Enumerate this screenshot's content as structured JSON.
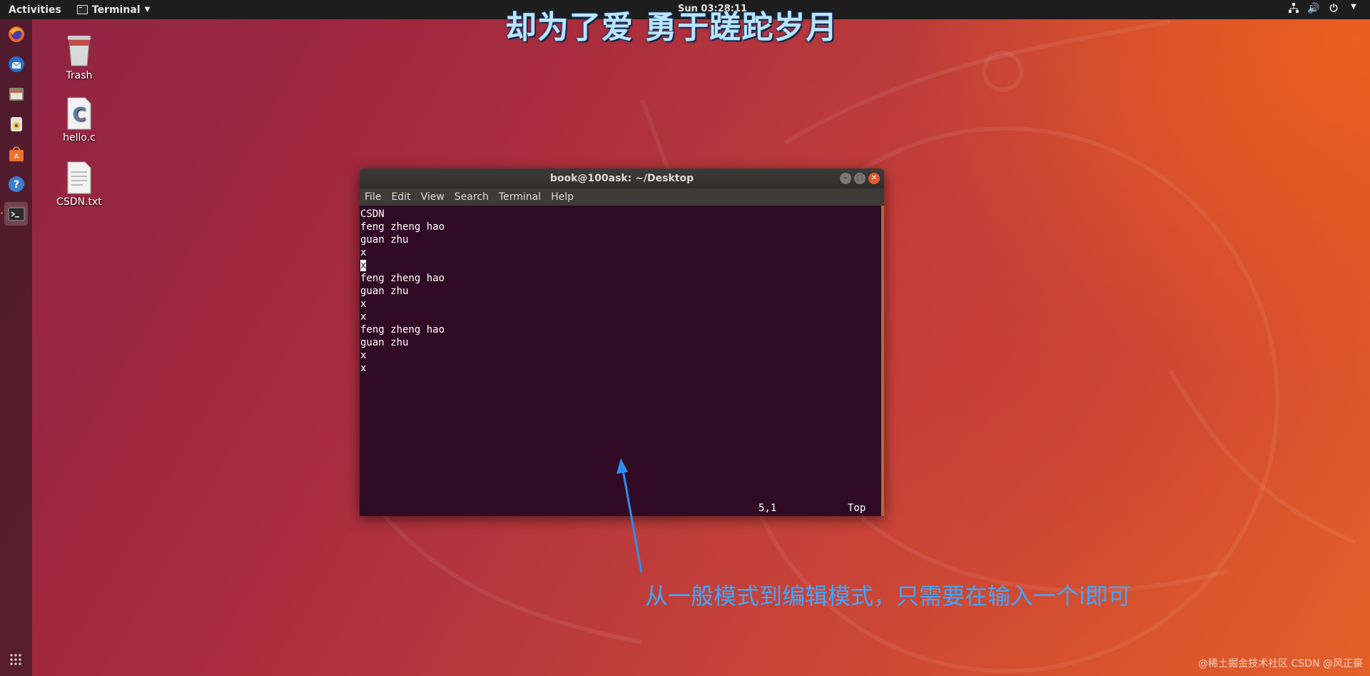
{
  "topbar": {
    "activities": "Activities",
    "app_name": "Terminal",
    "clock": "Sun 03:28:11"
  },
  "banner": "却为了爱 勇于蹉跎岁月",
  "dock": {
    "items": [
      {
        "name": "firefox"
      },
      {
        "name": "thunderbird"
      },
      {
        "name": "files"
      },
      {
        "name": "rhythmbox"
      },
      {
        "name": "software"
      },
      {
        "name": "help"
      },
      {
        "name": "terminal"
      }
    ]
  },
  "desktop": {
    "icons": [
      {
        "label": "Trash"
      },
      {
        "label": "hello.c"
      },
      {
        "label": "CSDN.txt"
      }
    ]
  },
  "window": {
    "title": "book@100ask: ~/Desktop",
    "menu": [
      "File",
      "Edit",
      "View",
      "Search",
      "Terminal",
      "Help"
    ],
    "lines": [
      "CSDN",
      "feng zheng hao",
      "guan zhu",
      "x",
      "x",
      "feng zheng hao",
      "guan zhu",
      "x",
      "x",
      "feng zheng hao",
      "guan zhu",
      "x",
      "x"
    ],
    "status_position": "5,1",
    "status_scroll": "Top"
  },
  "annotation": "从一般模式到编辑模式，只需要在输入一个i即可",
  "watermark": "@稀土掘金技术社区 CSDN @风正豪",
  "colors": {
    "terminal_bg": "#300a24",
    "annotation": "#3fa7ff",
    "accent": "#e95420"
  }
}
